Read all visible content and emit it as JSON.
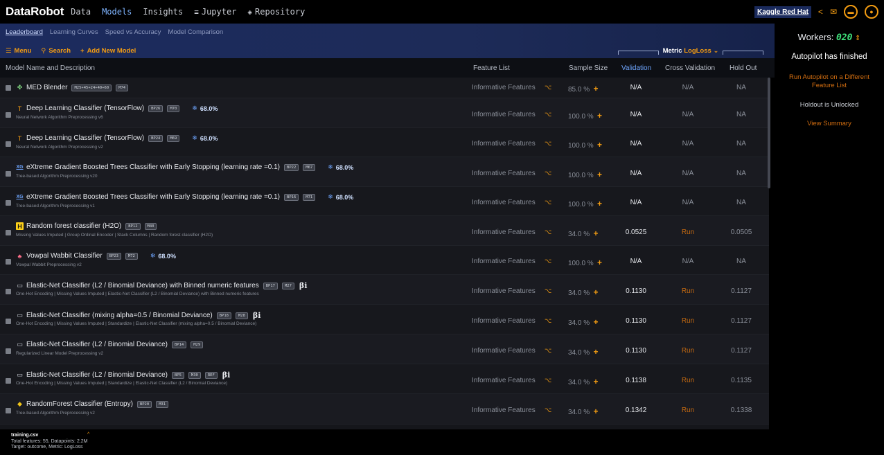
{
  "nav": {
    "logo_part1": "Data",
    "logo_part2": "Robot",
    "items": [
      {
        "label": "Data",
        "icon": ""
      },
      {
        "label": "Models",
        "icon": ""
      },
      {
        "label": "Insights",
        "icon": ""
      },
      {
        "label": "Jupyter",
        "icon": "jupyter-icon"
      },
      {
        "label": "Repository",
        "icon": "repository-icon"
      }
    ],
    "project": "Kaggle Red Hat"
  },
  "subnav": {
    "tabs": [
      "Leaderboard",
      "Learning Curves",
      "Speed vs Accuracy",
      "Model Comparison"
    ],
    "menu": "Menu",
    "search": "Search",
    "add": "Add New Model",
    "metric_label": "Metric",
    "metric_value": "LogLoss"
  },
  "table": {
    "headers": {
      "name": "Model Name and Description",
      "feature": "Feature List",
      "sample": "Sample Size",
      "validation": "Validation",
      "cv": "Cross Validation",
      "holdout": "Hold Out"
    },
    "rows": [
      {
        "name": "MED Blender",
        "badges": [
          "M25+45+24+40+60",
          "M74"
        ],
        "pct": "",
        "beta": "",
        "desc": "",
        "icon": "blender-icon",
        "feature": "Informative Features",
        "sample": "85.0 %",
        "validation": "N/A",
        "cv": "N/A",
        "holdout": "NA"
      },
      {
        "name": "Deep Learning Classifier (TensorFlow)",
        "badges": [
          "BP26",
          "M70"
        ],
        "pct": "68.0%",
        "beta": "",
        "desc": "Neural Network Algorithm Preprocessing v6",
        "icon": "tensorflow-icon",
        "feature": "Informative Features",
        "sample": "100.0 %",
        "validation": "N/A",
        "cv": "N/A",
        "holdout": "NA"
      },
      {
        "name": "Deep Learning Classifier (TensorFlow)",
        "badges": [
          "BP24",
          "M69"
        ],
        "pct": "68.0%",
        "beta": "",
        "desc": "Neural Network Algorithm Preprocessing v2",
        "icon": "tensorflow-icon",
        "feature": "Informative Features",
        "sample": "100.0 %",
        "validation": "N/A",
        "cv": "N/A",
        "holdout": "NA"
      },
      {
        "name": "eXtreme Gradient Boosted Trees Classifier with Early Stopping (learning rate =0.1)",
        "badges": [
          "BP22",
          "M67"
        ],
        "pct": "68.0%",
        "beta": "",
        "desc": "Tree-based Algorithm Preprocessing v20",
        "icon": "xgboost-icon",
        "feature": "Informative Features",
        "sample": "100.0 %",
        "validation": "N/A",
        "cv": "N/A",
        "holdout": "NA"
      },
      {
        "name": "eXtreme Gradient Boosted Trees Classifier with Early Stopping (learning rate =0.1)",
        "badges": [
          "BP16",
          "M71"
        ],
        "pct": "68.0%",
        "beta": "",
        "desc": "Tree-based Algorithm Preprocessing v1",
        "icon": "xgboost-icon",
        "feature": "Informative Features",
        "sample": "100.0 %",
        "validation": "N/A",
        "cv": "N/A",
        "holdout": "NA"
      },
      {
        "name": "Random forest classifier (H2O)",
        "badges": [
          "BP12",
          "M40"
        ],
        "pct": "",
        "beta": "",
        "desc": "Missing Values Imputed | Group Ordinal Encoder | Stack Columns | Random forest classifier (H2O)",
        "icon": "h2o-icon",
        "feature": "Informative Features",
        "sample": "34.0 %",
        "validation": "0.0525",
        "cv": "Run",
        "holdout": "0.0505"
      },
      {
        "name": "Vowpal Wabbit Classifier",
        "badges": [
          "BP23",
          "M72"
        ],
        "pct": "68.0%",
        "beta": "",
        "desc": "Vowpal Wabbit Preprocessing v2",
        "icon": "vowpal-icon",
        "feature": "Informative Features",
        "sample": "100.0 %",
        "validation": "N/A",
        "cv": "N/A",
        "holdout": "NA"
      },
      {
        "name": "Elastic-Net Classifier (L2 / Binomial Deviance) with Binned numeric features",
        "badges": [
          "BP17",
          "M27"
        ],
        "pct": "",
        "beta": "βi",
        "desc": "One-Hot Encoding | Missing Values Imputed | Elastic-Net Classifier (L2 / Binomial Deviance) with Binned numeric features",
        "icon": "elastic-net-icon",
        "feature": "Informative Features",
        "sample": "34.0 %",
        "validation": "0.1130",
        "cv": "Run",
        "holdout": "0.1127"
      },
      {
        "name": "Elastic-Net Classifier (mixing alpha=0.5 / Binomial Deviance)",
        "badges": [
          "BP18",
          "M28"
        ],
        "pct": "",
        "beta": "βi",
        "desc": "One-Hot Encoding | Missing Values Imputed | Standardize | Elastic-Net Classifier (mixing alpha=0.5 / Binomial Deviance)",
        "icon": "elastic-net-icon",
        "feature": "Informative Features",
        "sample": "34.0 %",
        "validation": "0.1130",
        "cv": "Run",
        "holdout": "0.1127"
      },
      {
        "name": "Elastic-Net Classifier (L2 / Binomial Deviance)",
        "badges": [
          "BP14",
          "M29"
        ],
        "pct": "",
        "beta": "",
        "desc": "Regularized Linear Model Preprocessing v2",
        "icon": "elastic-net-icon",
        "feature": "Informative Features",
        "sample": "34.0 %",
        "validation": "0.1130",
        "cv": "Run",
        "holdout": "0.1127"
      },
      {
        "name": "Elastic-Net Classifier (L2 / Binomial Deviance)",
        "badges": [
          "BP5",
          "M30",
          "REF"
        ],
        "pct": "",
        "beta": "βi",
        "desc": "One-Hot Encoding | Missing Values Imputed | Standardize | Elastic-Net Classifier (L2 / Binomial Deviance)",
        "icon": "elastic-net-icon",
        "feature": "Informative Features",
        "sample": "34.0 %",
        "validation": "0.1138",
        "cv": "Run",
        "holdout": "0.1135"
      },
      {
        "name": "RandomForest Classifier (Entropy)",
        "badges": [
          "BP20",
          "M31"
        ],
        "pct": "",
        "beta": "",
        "desc": "Tree-based Algorithm Preprocessing v2",
        "icon": "python-icon",
        "feature": "Informative Features",
        "sample": "34.0 %",
        "validation": "0.1342",
        "cv": "Run",
        "holdout": "0.1338"
      }
    ]
  },
  "right": {
    "workers_label": "Workers:",
    "workers_value": "020",
    "autopilot_status": "Autopilot has finished",
    "run_link": "Run Autopilot on a Different Feature List",
    "holdout_status": "Holdout is Unlocked",
    "view_summary": "View Summary"
  },
  "footer": {
    "filename": "training.csv",
    "stats": "Total features: 55, Datapoints: 2.2M",
    "target": "Target: outcome, Metric: LogLoss"
  },
  "colors": {
    "accent": "#f39c12",
    "link_blue": "#6fa6ff",
    "workers_green": "#3fe07a"
  }
}
